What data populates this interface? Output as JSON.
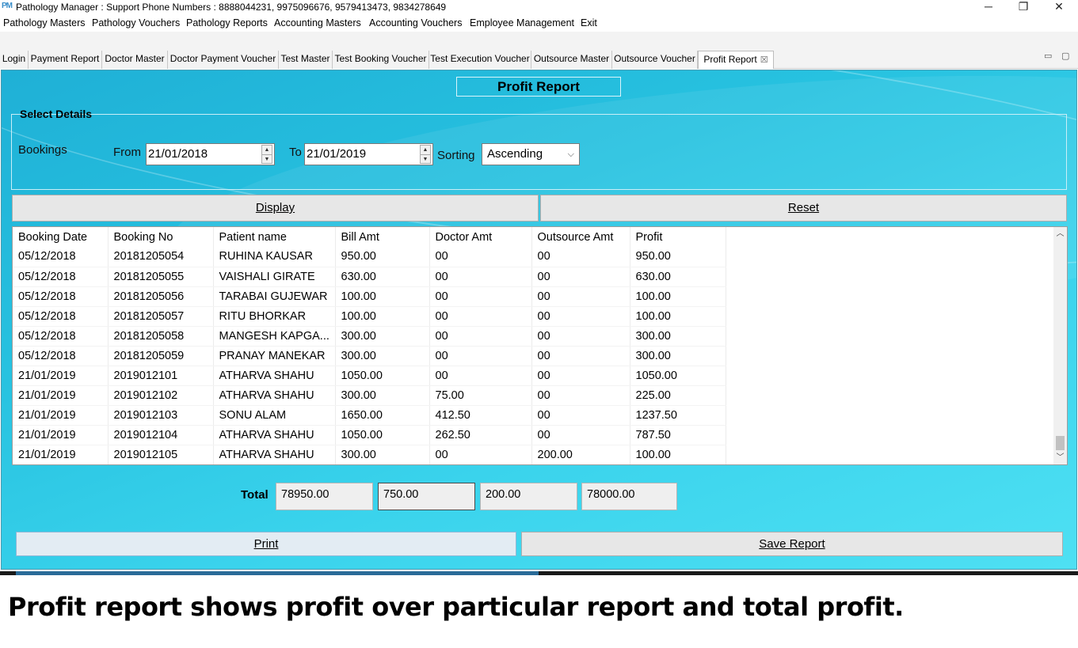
{
  "window": {
    "app_icon": "PM",
    "title": "Pathology Manager : Support Phone Numbers : 8888044231, 9975096676, 9579413473, 9834278649",
    "minimize": "─",
    "restore": "❐",
    "close": "✕"
  },
  "menu": [
    "Pathology Masters",
    "Pathology Vouchers",
    "Pathology Reports",
    "Accounting Masters",
    "Accounting Vouchers",
    "Employee Management",
    "Exit"
  ],
  "tabs": [
    "Login",
    "Payment Report",
    "Doctor Master",
    "Doctor Payment Voucher",
    "Test Master",
    "Test Booking Voucher",
    "Test Execution Voucher",
    "Outsource Master",
    "Outsource Voucher",
    "Profit Report"
  ],
  "tab_close": "☒",
  "report": {
    "title": "Profit Report",
    "select_details": "Select Details",
    "bookings_label": "Bookings",
    "from_label": "From",
    "from_value": "21/01/2018",
    "to_label": "To",
    "to_value": "21/01/2019",
    "sorting_label": "Sorting",
    "sorting_value": "Ascending",
    "display_label": "Display",
    "reset_label": "Reset",
    "total_label": "Total",
    "totals": [
      "78950.00",
      "750.00",
      "200.00",
      "78000.00"
    ],
    "print_label": "Print",
    "save_label": "Save Report"
  },
  "table": {
    "columns": [
      "Booking Date",
      "Booking No",
      "Patient name",
      "Bill Amt",
      "Doctor Amt",
      "Outsource Amt",
      "Profit"
    ],
    "rows": [
      [
        "05/12/2018",
        "20181205054",
        "RUHINA KAUSAR",
        "950.00",
        "00",
        "00",
        "950.00"
      ],
      [
        "05/12/2018",
        "20181205055",
        "VAISHALI GIRATE",
        "630.00",
        "00",
        "00",
        "630.00"
      ],
      [
        "05/12/2018",
        "20181205056",
        "TARABAI GUJEWAR",
        "100.00",
        "00",
        "00",
        "100.00"
      ],
      [
        "05/12/2018",
        "20181205057",
        "RITU BHORKAR",
        "100.00",
        "00",
        "00",
        "100.00"
      ],
      [
        "05/12/2018",
        "20181205058",
        "MANGESH KAPGA...",
        "300.00",
        "00",
        "00",
        "300.00"
      ],
      [
        "05/12/2018",
        "20181205059",
        "PRANAY MANEKAR",
        "300.00",
        "00",
        "00",
        "300.00"
      ],
      [
        "21/01/2019",
        "2019012101",
        "ATHARVA SHAHU",
        "1050.00",
        "00",
        "00",
        "1050.00"
      ],
      [
        "21/01/2019",
        "2019012102",
        "ATHARVA SHAHU",
        "300.00",
        "75.00",
        "00",
        "225.00"
      ],
      [
        "21/01/2019",
        "2019012103",
        "SONU ALAM",
        "1650.00",
        "412.50",
        "00",
        "1237.50"
      ],
      [
        "21/01/2019",
        "2019012104",
        "ATHARVA SHAHU",
        "1050.00",
        "262.50",
        "00",
        "787.50"
      ],
      [
        "21/01/2019",
        "2019012105",
        "ATHARVA SHAHU",
        "300.00",
        "00",
        "200.00",
        "100.00"
      ]
    ]
  },
  "caption": "Profit report shows profit over particular report and total profit."
}
